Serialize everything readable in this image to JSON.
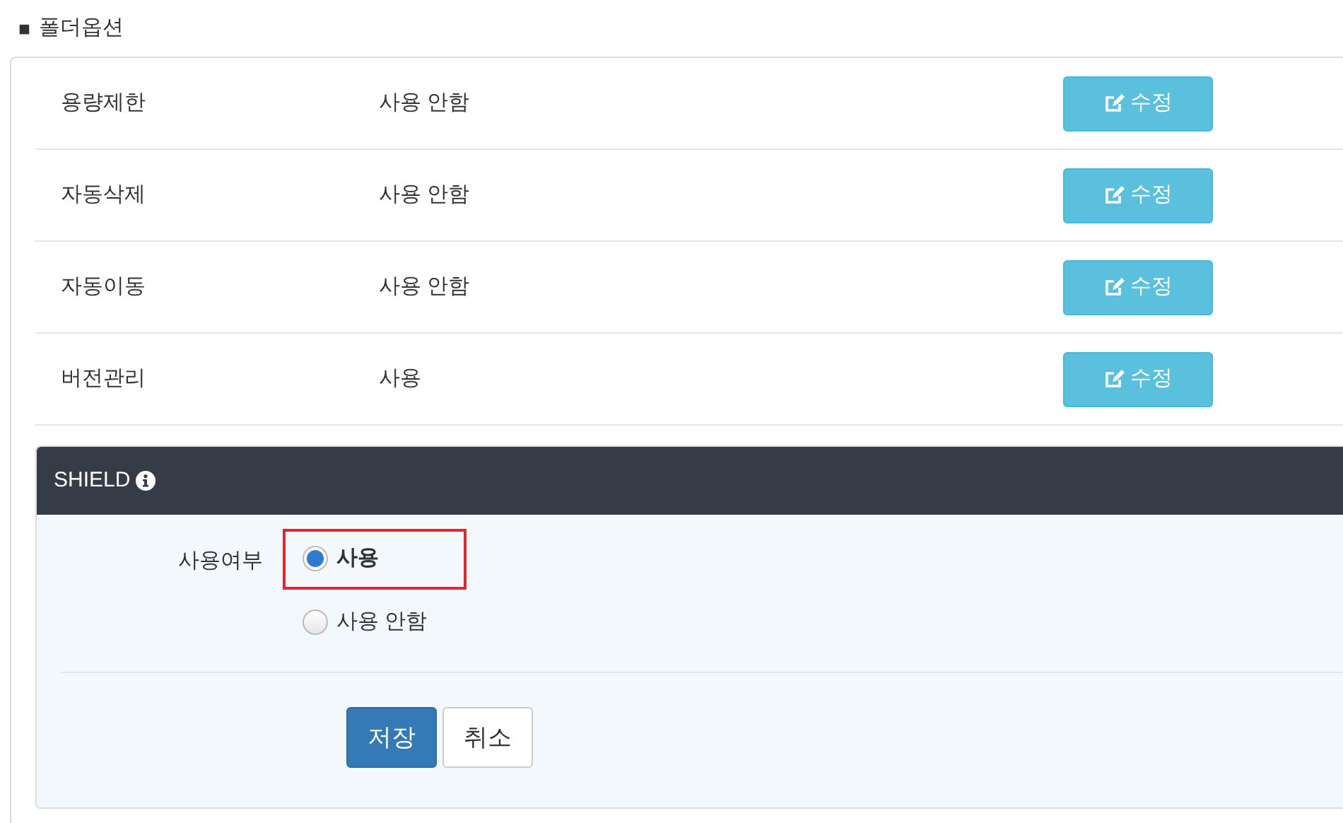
{
  "section_title": {
    "bullet": "■",
    "text": "폴더옵션"
  },
  "options": [
    {
      "label": "용량제한",
      "value": "사용 안함",
      "button": "수정"
    },
    {
      "label": "자동삭제",
      "value": "사용 안함",
      "button": "수정"
    },
    {
      "label": "자동이동",
      "value": "사용 안함",
      "button": "수정"
    },
    {
      "label": "버전관리",
      "value": "사용",
      "button": "수정"
    }
  ],
  "shield": {
    "title": "SHIELD",
    "field_label": "사용여부",
    "radios": [
      {
        "label": "사용",
        "selected": true,
        "highlighted": true
      },
      {
        "label": "사용 안함",
        "selected": false,
        "highlighted": false
      }
    ],
    "buttons": [
      {
        "label": "저장",
        "kind": "primary"
      },
      {
        "label": "취소",
        "kind": "secondary"
      }
    ]
  }
}
